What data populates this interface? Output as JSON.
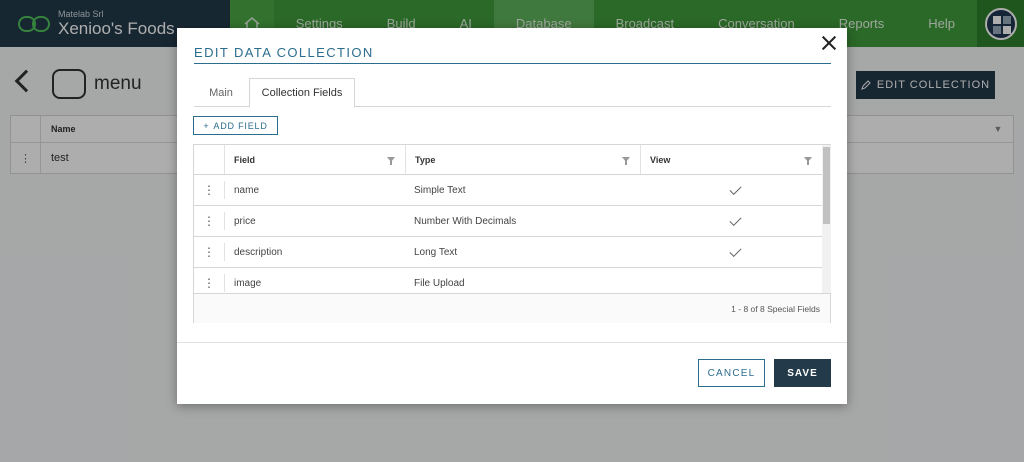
{
  "brand": {
    "company": "Matelab Srl",
    "name": "Xenioo's Foods"
  },
  "nav": {
    "items": [
      {
        "label": "Settings"
      },
      {
        "label": "Build"
      },
      {
        "label": "AI"
      },
      {
        "label": "Database"
      },
      {
        "label": "Broadcast"
      },
      {
        "label": "Conversation"
      },
      {
        "label": "Reports"
      },
      {
        "label": "Help"
      }
    ],
    "active": "Database"
  },
  "page": {
    "title": "menu",
    "edit_collection_label": "EDIT COLLECTION",
    "table": {
      "header": "Name",
      "rows": [
        {
          "name": "test"
        }
      ]
    }
  },
  "modal": {
    "title": "EDIT DATA COLLECTION",
    "tabs": [
      {
        "label": "Main"
      },
      {
        "label": "Collection Fields"
      }
    ],
    "active_tab": "Collection Fields",
    "add_field_label": "ADD FIELD",
    "columns": {
      "field": "Field",
      "type": "Type",
      "view": "View"
    },
    "rows": [
      {
        "field": "name",
        "type": "Simple Text",
        "view": true
      },
      {
        "field": "price",
        "type": "Number With Decimals",
        "view": true
      },
      {
        "field": "description",
        "type": "Long Text",
        "view": true
      },
      {
        "field": "image",
        "type": "File Upload",
        "view": false
      }
    ],
    "footer": "1 - 8 of 8 Special Fields",
    "cancel_label": "CANCEL",
    "save_label": "SAVE"
  },
  "colors": {
    "nav_bg": "#3f9b3a",
    "brand_bg": "#233a4b",
    "accent": "#2b6d8e",
    "primary_button": "#233a4b"
  }
}
